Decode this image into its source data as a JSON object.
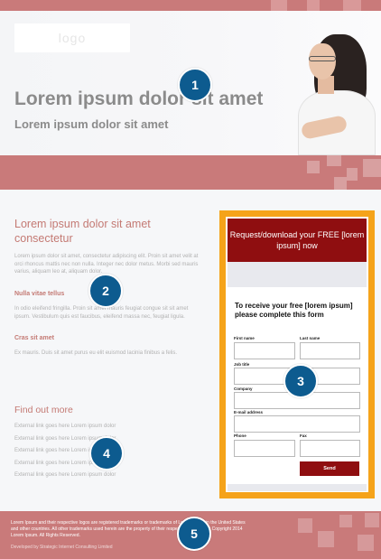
{
  "header": {
    "logo_text": "logo",
    "title": "Lorem ipsum dolor sit amet",
    "subtitle": "Lorem ipsum dolor sit amet"
  },
  "intro": {
    "title": "Lorem ipsum dolor sit amet consectetur",
    "paragraph1": "Lorem ipsum dolor sit amet, consectetur adipiscing elit. Proin sit amet velit at orci rhoncus mattis nec non nulla. Integer nec dolor metus. Morbi sed mauris varius, aliquam leo at, aliquam dolor.",
    "subhead1": "Nulla vitae tellus",
    "paragraph2": "In odio eleifend fringilla. Proin sit amet mauris feugiat congue sit sit amet ipsum. Vestibulum quis est faucibus, eleifend massa nec, feugiat ligula.",
    "subhead2": "Cras sit amet",
    "paragraph3": "Ex mauris. Duis sit amet purus eu elit euismod lacinia finibus a felis."
  },
  "find_more": {
    "title": "Find out more",
    "links": [
      "External link goes here Lorem ipsum dolor",
      "External link goes here Lorem ipsum dolor",
      "External link goes here Lorem ipsum dolor",
      "External link goes here Lorem ipsum dolor",
      "External link goes here Lorem ipsum dolor"
    ]
  },
  "form": {
    "header": "Request/download your FREE [lorem ipsum] now",
    "intro": "To receive your free [lorem ipsum] please complete this form",
    "first_name_label": "First name",
    "last_name_label": "Last name",
    "job_title_label": "Job title",
    "company_label": "Company",
    "email_label": "E-mail address",
    "phone_label": "Phone",
    "fax_label": "Fax",
    "send_label": "Send"
  },
  "footer": {
    "legal": "Lorem Ipsum and their respective logos are registered trademarks or trademarks of Lorem Ipsum in the United States and other countries. All other trademarks used herein are the property of their respective owners. (c) Copyright 2014 Lorem Ipsum. All Rights Reserved.",
    "developer": "Developed by Strategic Internet Consulting Limited"
  },
  "markers": [
    "1",
    "2",
    "3",
    "4",
    "5"
  ],
  "colors": {
    "accent_pink": "#c97a7a",
    "heading_rose": "#c47a74",
    "form_red": "#8f0e10",
    "form_border_orange": "#f5a31a",
    "marker_blue": "#0d5b8f"
  }
}
